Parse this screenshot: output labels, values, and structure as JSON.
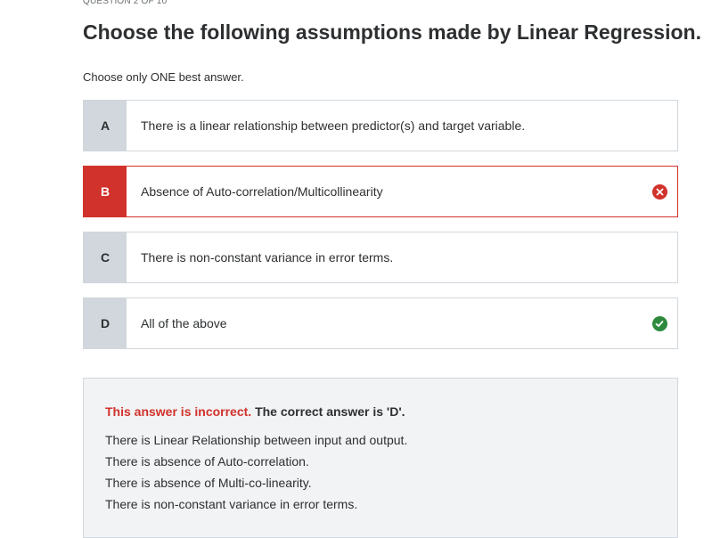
{
  "question": {
    "counter": "QUESTION 2 OF 10",
    "title": "Choose the following assumptions made by Linear Regression.",
    "instruction": "Choose only ONE best answer."
  },
  "options": [
    {
      "letter": "A",
      "text": "There is a linear relationship between predictor(s) and target variable.",
      "status": ""
    },
    {
      "letter": "B",
      "text": "Absence of Auto-correlation/Multicollinearity",
      "status": "incorrect-icon"
    },
    {
      "letter": "C",
      "text": "There is non-constant variance in error terms.",
      "status": ""
    },
    {
      "letter": "D",
      "text": "All of the above",
      "status": "correct-icon"
    }
  ],
  "feedback": {
    "incorrect_label": "This answer is incorrect.",
    "correct_answer": "The correct answer is 'D'.",
    "explanation": [
      "There is Linear Relationship between input and output.",
      "There is absence of Auto-correlation.",
      "There is absence of Multi-co-linearity.",
      "There is non-constant variance in error terms."
    ]
  },
  "colors": {
    "incorrect": "#d1322b",
    "correct": "#2e8b3e",
    "letter_bg": "#d1d7dc",
    "feedback_bg": "#f2f3f5"
  }
}
